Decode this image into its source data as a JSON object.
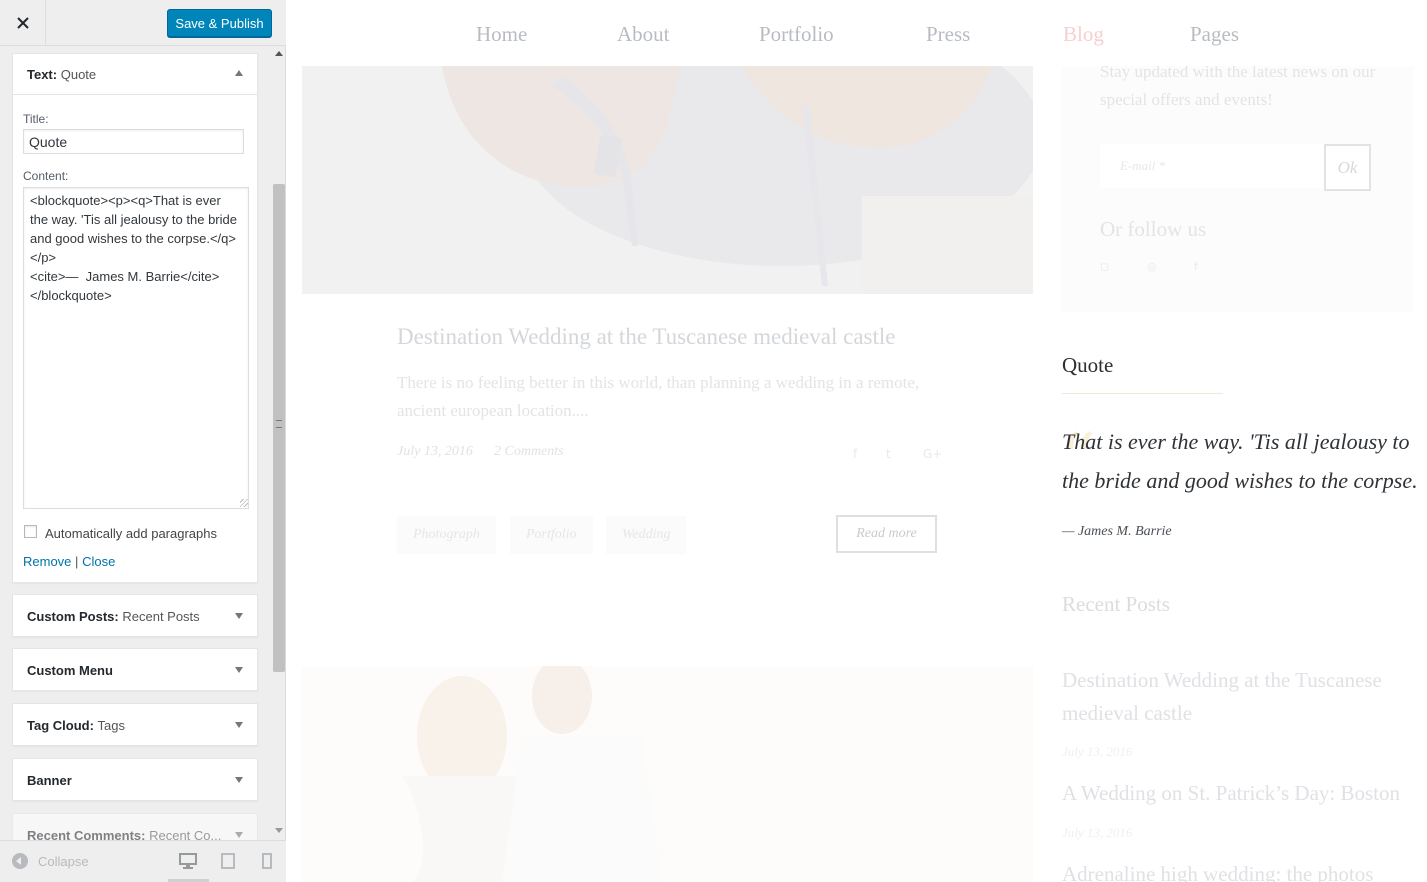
{
  "customizer": {
    "save_label": "Save & Publish",
    "active_widget": {
      "type": "Text:",
      "name": "Quote",
      "title_label": "Title:",
      "title_value": "Quote",
      "content_label": "Content:",
      "content_value": "<blockquote><p><q>That is ever the way. 'Tis all jealousy to the bride and good wishes to the corpse.</q></p>\n<cite>—  James M. Barrie</cite>\n</blockquote>",
      "autop_label": "Automatically add paragraphs",
      "autop_checked": false,
      "remove_label": "Remove",
      "separator": "|",
      "close_label": "Close"
    },
    "widgets": [
      {
        "type": "Custom Posts:",
        "name": "Recent Posts"
      },
      {
        "type": "Custom Menu",
        "name": ""
      },
      {
        "type": "Tag Cloud:",
        "name": "Tags"
      },
      {
        "type": "Banner",
        "name": ""
      },
      {
        "type": "Recent Comments:",
        "name": "Recent Co..."
      }
    ],
    "collapse_label": "Collapse"
  },
  "site": {
    "nav": [
      {
        "label": "Home",
        "active": false
      },
      {
        "label": "About",
        "active": false
      },
      {
        "label": "Portfolio",
        "active": false
      },
      {
        "label": "Press",
        "active": false
      },
      {
        "label": "Blog",
        "active": true
      },
      {
        "label": "Pages",
        "active": false
      }
    ],
    "post": {
      "title": "Destination Wedding at the Tuscanese medieval castle",
      "excerpt": "There is no feeling better in this world, than planning a wedding in a remote, ancient european location....",
      "date": "July 13, 2016",
      "comments": "2 Comments",
      "tags": [
        "Photograph",
        "Portfolio",
        "Wedding"
      ],
      "read_more": "Read more",
      "share_icons": [
        "facebook-icon",
        "twitter-icon",
        "google-plus-icon"
      ]
    },
    "newsletter": {
      "text": "Stay updated with the latest news on our special offers and events!",
      "email_placeholder": "E-mail *",
      "ok_label": "Ok",
      "follow_title": "Or follow us",
      "social_icons": [
        "instagram-icon",
        "pinterest-icon",
        "facebook-icon"
      ]
    },
    "quote_widget": {
      "heading": "Quote",
      "quote_mark": "“",
      "text": "That is ever the way. 'Tis all jealousy to the bride and good wishes to the corpse.",
      "cite": "— James M. Barrie"
    },
    "recent_posts": {
      "heading": "Recent Posts",
      "items": [
        {
          "title": "Destination Wedding at the Tuscanese medieval castle",
          "date": "July 13, 2016"
        },
        {
          "title": "A Wedding on St. Patrick’s Day: Boston",
          "date": "July 13, 2016"
        },
        {
          "title": "Adrenaline high wedding: the photos",
          "date": ""
        }
      ]
    }
  }
}
